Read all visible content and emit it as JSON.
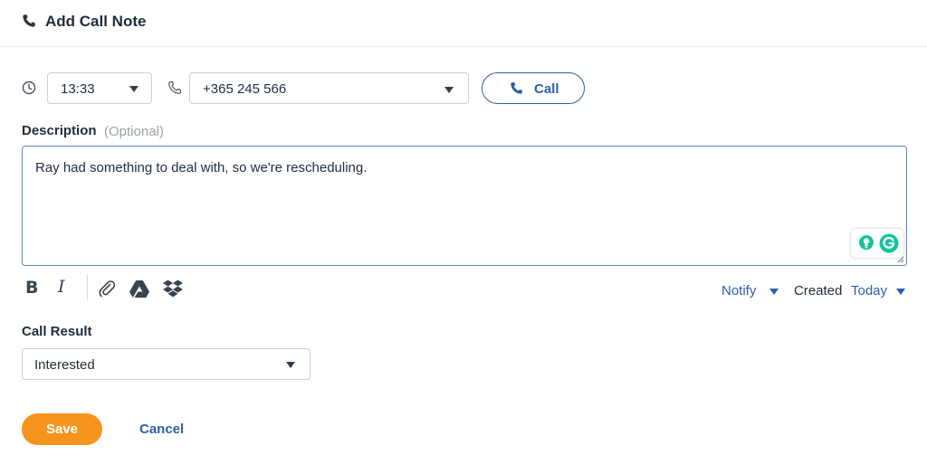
{
  "header": {
    "title": "Add Call Note",
    "icon": "phone-icon"
  },
  "call": {
    "time_value": "13:33",
    "phone_value": "+365 245 566",
    "call_button_label": "Call"
  },
  "description": {
    "label": "Description",
    "optional_hint": "(Optional)",
    "text": "Ray had something to deal with, so we're rescheduling."
  },
  "toolbar": {
    "icons": [
      "bold-icon",
      "italic-icon",
      "paperclip-icon",
      "google-drive-icon",
      "dropbox-icon"
    ],
    "bold_glyph": "B",
    "italic_glyph": "I",
    "notify_label": "Notify",
    "created_label": "Created",
    "created_value": "Today"
  },
  "call_result": {
    "label": "Call Result",
    "value": "Interested"
  },
  "actions": {
    "save_label": "Save",
    "cancel_label": "Cancel"
  },
  "colors": {
    "accent_blue": "#2f5fa8",
    "save_orange": "#f7941d",
    "grammarly_green": "#15c39a"
  }
}
